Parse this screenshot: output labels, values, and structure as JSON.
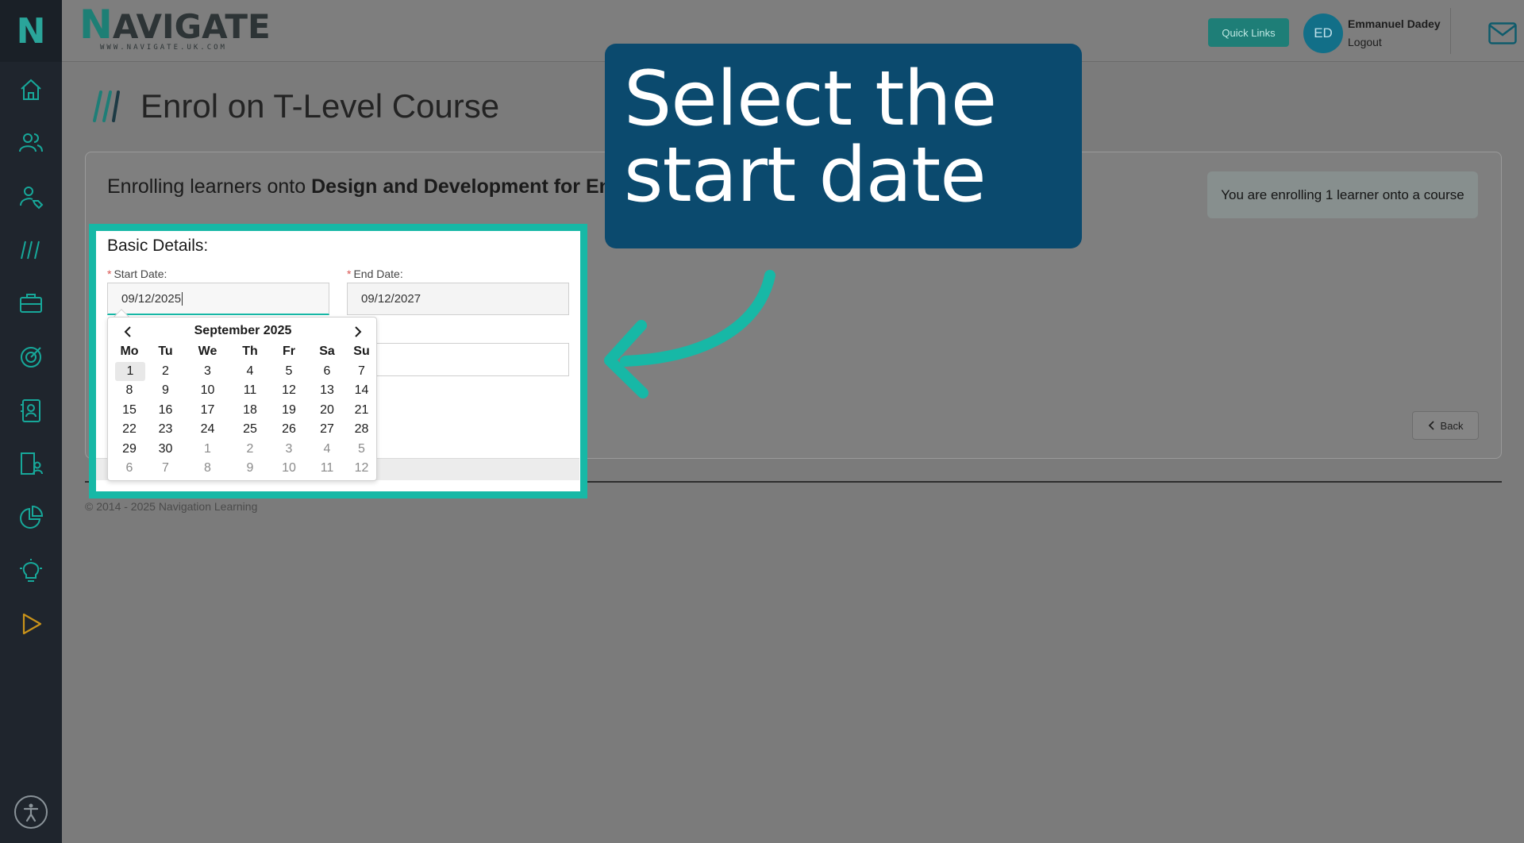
{
  "sidebar": {
    "logo_letter": "N",
    "items": [
      {
        "icon": "home-icon"
      },
      {
        "icon": "users-icon"
      },
      {
        "icon": "user-tag-icon"
      },
      {
        "icon": "courses-slashes-icon"
      },
      {
        "icon": "briefcase-icon"
      },
      {
        "icon": "target-icon"
      },
      {
        "icon": "contact-card-icon"
      },
      {
        "icon": "building-user-icon"
      },
      {
        "icon": "pie-chart-icon"
      },
      {
        "icon": "lightbulb-icon"
      },
      {
        "icon": "play-icon"
      }
    ],
    "accessibility_icon": "accessibility-icon"
  },
  "header": {
    "brand_first": "N",
    "brand_rest": "AVIGATE",
    "brand_url": "WWW.NAVIGATE.UK.COM",
    "quick_links": "Quick Links",
    "avatar_initials": "ED",
    "user_name": "Emmanuel Dadey",
    "logout": "Logout",
    "mail_icon": "mail-icon"
  },
  "page": {
    "title": "Enrol on T-Level Course",
    "enrol_prefix": "Enrolling learners onto ",
    "enrol_course": "Design and Development for Engi",
    "enrol_badge": "You are enrolling 1 learner onto a course",
    "back_label": "Back",
    "footer": "© 2014 - 2025 Navigation Learning"
  },
  "form": {
    "section_title": "Basic Details:",
    "start_label": "Start Date:",
    "start_value": "09/12/2025",
    "end_label": "End Date:",
    "end_value": "09/12/2027",
    "required_mark": "*"
  },
  "calendar": {
    "month_label": "September 2025",
    "days_of_week": [
      "Mo",
      "Tu",
      "We",
      "Th",
      "Fr",
      "Sa",
      "Su"
    ],
    "weeks": [
      [
        {
          "d": "1",
          "t": "today"
        },
        {
          "d": "2"
        },
        {
          "d": "3"
        },
        {
          "d": "4"
        },
        {
          "d": "5"
        },
        {
          "d": "6"
        },
        {
          "d": "7"
        }
      ],
      [
        {
          "d": "8"
        },
        {
          "d": "9"
        },
        {
          "d": "10"
        },
        {
          "d": "11"
        },
        {
          "d": "12"
        },
        {
          "d": "13"
        },
        {
          "d": "14"
        }
      ],
      [
        {
          "d": "15"
        },
        {
          "d": "16"
        },
        {
          "d": "17"
        },
        {
          "d": "18"
        },
        {
          "d": "19"
        },
        {
          "d": "20"
        },
        {
          "d": "21"
        }
      ],
      [
        {
          "d": "22"
        },
        {
          "d": "23"
        },
        {
          "d": "24"
        },
        {
          "d": "25"
        },
        {
          "d": "26"
        },
        {
          "d": "27"
        },
        {
          "d": "28"
        }
      ],
      [
        {
          "d": "29"
        },
        {
          "d": "30"
        },
        {
          "d": "1",
          "t": "other"
        },
        {
          "d": "2",
          "t": "other"
        },
        {
          "d": "3",
          "t": "other"
        },
        {
          "d": "4",
          "t": "other"
        },
        {
          "d": "5",
          "t": "other"
        }
      ],
      [
        {
          "d": "6",
          "t": "other"
        },
        {
          "d": "7",
          "t": "other"
        },
        {
          "d": "8",
          "t": "other"
        },
        {
          "d": "9",
          "t": "other"
        },
        {
          "d": "10",
          "t": "other"
        },
        {
          "d": "11",
          "t": "other"
        },
        {
          "d": "12",
          "t": "other"
        }
      ]
    ]
  },
  "callout": {
    "text": "Select the start date"
  },
  "colors": {
    "accent": "#17b8a6",
    "callout_bg": "#0b4a6e",
    "sidebar_bg": "#1f252d",
    "overlay_bg": "#7b7b7b"
  }
}
